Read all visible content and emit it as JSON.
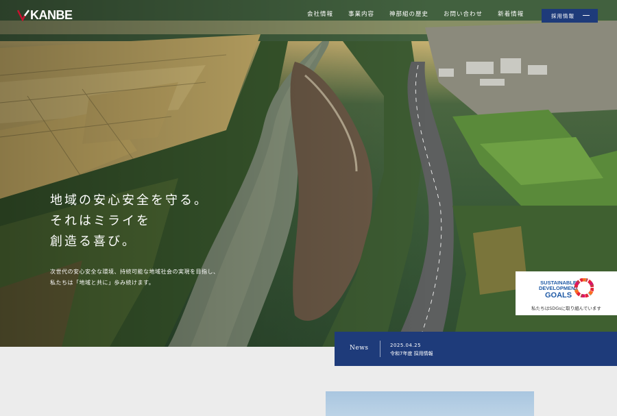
{
  "header": {
    "logo_text": "KANBE",
    "nav": [
      "会社情報",
      "事業内容",
      "神部組の歴史",
      "お問い合わせ",
      "新着情報"
    ],
    "recruit_label": "採用情報"
  },
  "hero": {
    "headline_lines": [
      "地域の安心安全を守る。",
      "それはミライを",
      "創造る喜び。"
    ],
    "sub_lines": [
      "次世代の安心安全な環境、持続可能な地域社会の実現を目指し、",
      "私たちは「地域と共に」歩み続けます。"
    ]
  },
  "sdgs": {
    "title_top": "SUSTAINABLE",
    "title_mid": "DEVELOPMENT",
    "title_goals": "GOALS",
    "caption": "私たちはSDGsに取り組んでいます"
  },
  "news": {
    "label": "News",
    "date": "2025.04.25",
    "title": "令和7年度 採用情報"
  },
  "colors": {
    "brand_navy": "#1e3b7a",
    "sdgs_blue": "#1f5aa6"
  },
  "icons": {
    "logo_mark": "kanbe-logo-icon",
    "arrow": "arrow-right-icon",
    "sdgs_wheel": "sdgs-wheel-icon"
  }
}
